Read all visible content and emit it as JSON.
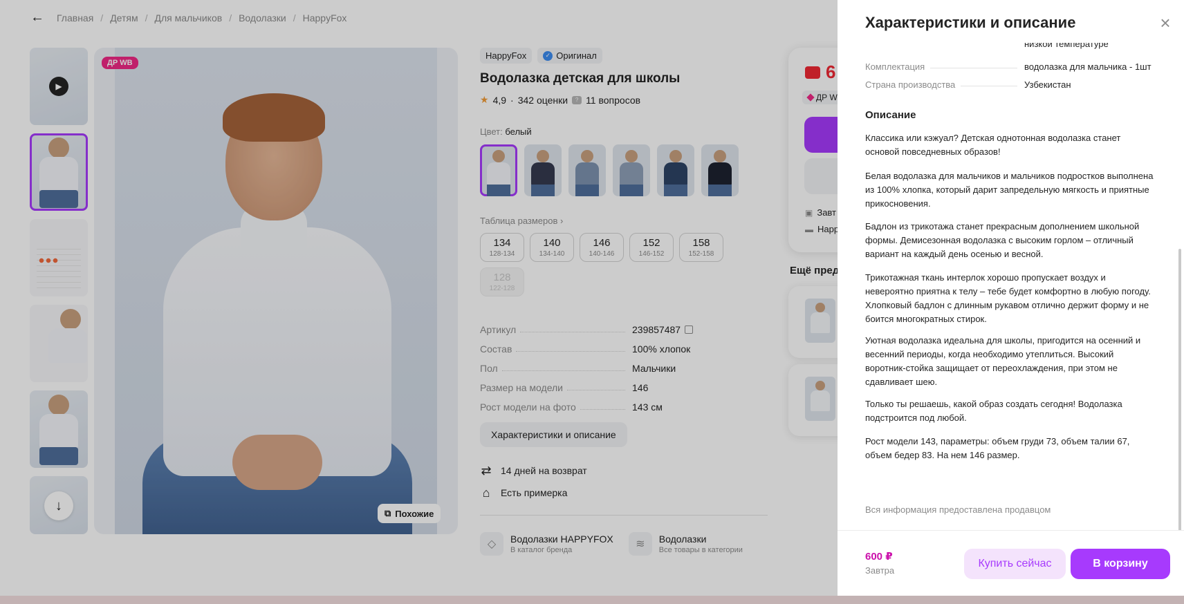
{
  "breadcrumbs": {
    "back_icon": "arrow-left-icon",
    "items": [
      "Главная",
      "Детям",
      "Для мальчиков",
      "Водолазки",
      "HappyFox"
    ],
    "separator": "/"
  },
  "gallery": {
    "badge": "ДР WB",
    "similar_label": "Похожие",
    "play_icon": "play-icon",
    "down_icon": "arrow-down-icon"
  },
  "product": {
    "brand": "HappyFox",
    "original_label": "Оригинал",
    "title": "Водолазка детская для школы",
    "rating": "4,9",
    "reviews": "342 оценки",
    "questions": "11 вопросов",
    "color_prefix": "Цвет:",
    "color_value": "белый",
    "size_table_link": "Таблица размеров ›",
    "sizes": [
      {
        "big": "134",
        "small": "128-134",
        "available": true
      },
      {
        "big": "140",
        "small": "134-140",
        "available": true
      },
      {
        "big": "146",
        "small": "140-146",
        "available": true
      },
      {
        "big": "152",
        "small": "146-152",
        "available": true
      },
      {
        "big": "158",
        "small": "152-158",
        "available": true
      },
      {
        "big": "128",
        "small": "122-128",
        "available": false
      }
    ],
    "params": [
      {
        "key": "Артикул",
        "value": "239857487"
      },
      {
        "key": "Состав",
        "value": "100% хлопок"
      },
      {
        "key": "Пол",
        "value": "Мальчики"
      },
      {
        "key": "Размер на модели",
        "value": "146"
      },
      {
        "key": "Рост модели на фото",
        "value": "143 см"
      }
    ],
    "char_button": "Характеристики и описание",
    "return_text": "14 дней на возврат",
    "fitting_text": "Есть примерка",
    "brand_link": {
      "title": "Водолазки HAPPYFOX",
      "sub": "В каталог бренда"
    },
    "category_link": {
      "title": "Водолазки",
      "sub": "Все товары в категории"
    }
  },
  "buy_card": {
    "price_fragment": "6",
    "badge_fragment": "ДР W",
    "delivery_fragment": "Завт",
    "pickup_fragment": "Нарр"
  },
  "more_title": "Ещё пред",
  "drawer": {
    "title": "Характеристики и описание",
    "close_icon": "close-icon",
    "cut_text": "низкой температуре",
    "specs": [
      {
        "key": "Комплектация",
        "value": "водолазка для мальчика - 1шт"
      },
      {
        "key": "Страна производства",
        "value": "Узбекистан"
      }
    ],
    "desc_title": "Описание",
    "paragraphs": [
      "Классика или кэжуал? Детская однотонная водолазка станет основой повседневных образов!",
      "Белая водолазка для мальчиков и мальчиков подростков выполнена из 100% хлопка, который дарит запредельную мягкость и приятные прикосновения.",
      "Бадлон из трикотажа станет прекрасным дополнением школьной формы. Демисезонная водолазка с высоким горлом – отличный вариант на каждый день осенью и весной.",
      "Трикотажная ткань интерлок хорошо пропускает воздух и невероятно приятна к телу – тебе будет комфортно в любую погоду. Хлопковый бадлон с длинным рукавом отлично держит форму и не боится многократных стирок.",
      "Уютная водолазка идеальна для школы, пригодится на осенний и весенний периоды, когда необходимо утеплиться. Высокий воротник-стойка защищает от переохлаждения, при этом не сдавливает шею.",
      "Только ты решаешь, какой образ создать сегодня! Водолазка подстроится под любой.",
      "Рост модели 143, параметры: объем груди 73, объем талии 67, объем бедер 83. На нем 146 размер."
    ],
    "footer_note": "Вся информация предоставлена продавцом",
    "price": "600 ₽",
    "delivery": "Завтра",
    "buy_now": "Купить сейчас",
    "add_to_cart": "В корзину"
  },
  "colors": {
    "accent": "#a73afd",
    "accent_light": "#f4e3fc",
    "price": "#cb11ab",
    "badge": "#f02886",
    "swatches": [
      "#f4f6fa",
      "#353a4f",
      "#7e93b0",
      "#8fa0b8",
      "#2e4466",
      "#1d2230"
    ]
  }
}
